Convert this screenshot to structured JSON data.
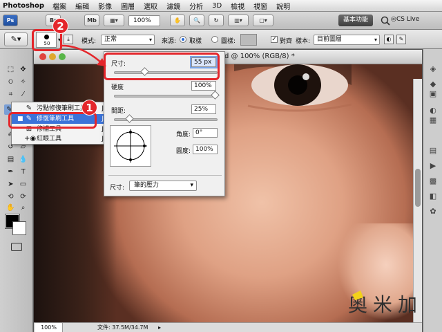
{
  "menubar": {
    "app": "Photoshop",
    "items": [
      "檔案",
      "編輯",
      "影像",
      "圖層",
      "選取",
      "濾鏡",
      "分析",
      "3D",
      "檢視",
      "視窗",
      "說明"
    ]
  },
  "appbar": {
    "br_label": "Br",
    "mb_label": "Mb",
    "zoom": "100%",
    "workspace": "基本功能",
    "cslive": "CS Live"
  },
  "options": {
    "brush_size": "50",
    "mode_label": "模式:",
    "mode_value": "正常",
    "source_label": "來源:",
    "source_sample": "取樣",
    "source_pattern": "圖樣:",
    "aligned_label": "對齊",
    "sample_label": "樣本:",
    "sample_value": "目前圖層"
  },
  "document": {
    "title": "d @ 100% (RGB/8) *",
    "zoom": "100%",
    "status": "文件: 37.5M/34.7M"
  },
  "flyout": {
    "items": [
      {
        "label": "污點修復筆刷工具",
        "key": "J",
        "icon": "spot-healing-icon",
        "bullet": ""
      },
      {
        "label": "修復筆刷工具",
        "key": "J",
        "icon": "healing-brush-icon",
        "bullet": "■"
      },
      {
        "label": "修補工具",
        "key": "J",
        "icon": "patch-icon",
        "bullet": ""
      },
      {
        "label": "紅眼工具",
        "key": "J",
        "icon": "red-eye-icon",
        "bullet": ""
      }
    ]
  },
  "popup": {
    "size_label": "尺寸:",
    "size_value": "55 px",
    "hardness_label": "硬度",
    "hardness_value": "100%",
    "spacing_label": "間距:",
    "spacing_value": "25%",
    "angle_label": "角度:",
    "angle_value": "0°",
    "roundness_label": "圓度:",
    "roundness_value": "100%",
    "size_control_label": "尺寸:",
    "size_control_value": "筆的壓力",
    "size_slider": 0.28,
    "hardness_slider": 1.0,
    "spacing_slider": 0.12
  },
  "annotations": {
    "badge1": "1",
    "badge2": "2",
    "color": "#e4262b"
  },
  "watermark": "奧米加"
}
